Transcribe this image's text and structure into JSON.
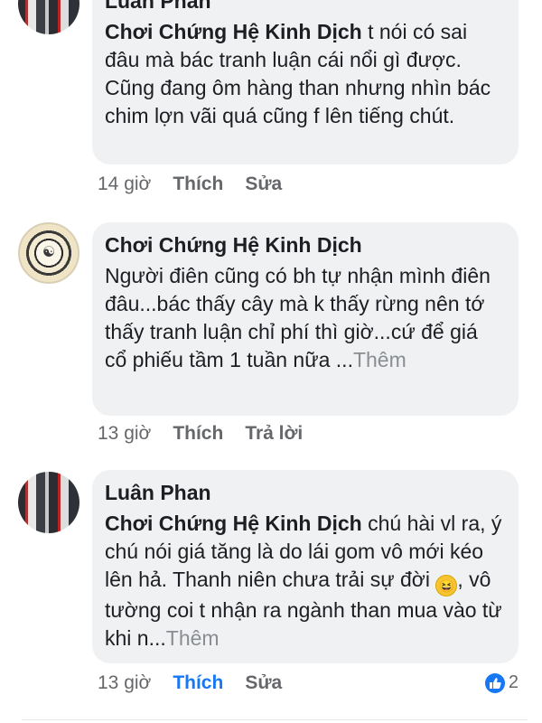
{
  "comments": [
    {
      "author": "Luân Phan",
      "tag": "Chơi Chứng Hệ Kinh Dịch",
      "text": " t nói có sai đâu mà bác tranh luận cái nổi gì được. Cũng đang ôm hàng than nhưng nhìn bác chim lợn vãi quá cũng f lên tiếng chút.",
      "time": "14 giờ",
      "like_label": "Thích",
      "second_action": "Sửa",
      "avatar_icon": "profile-photo-icon"
    },
    {
      "author": "Chơi Chứng Hệ Kinh Dịch",
      "text": "Người điên cũng có bh tự nhận mình điên đâu...bác thấy cây mà k thấy rừng nên tớ thấy tranh luận chỉ phí thì giờ...cứ để giá cổ phiếu tầm 1 tuần nữa ...",
      "more": "Thêm",
      "time": "13 giờ",
      "like_label": "Thích",
      "second_action": "Trả lời",
      "avatar_icon": "bagua-seal-icon"
    },
    {
      "author": "Luân Phan",
      "tag": "Chơi Chứng Hệ Kinh Dịch",
      "text_part1": " chú hài vl ra, ý chú nói giá tăng là do lái gom vô mới kéo lên hả. Thanh niên chưa trải sự đời ",
      "emoji": "😆",
      "text_part2": ", vô tường coi t nhận ra ngành than mua vào từ khi n...",
      "more": "Thêm",
      "time": "13 giờ",
      "like_label": "Thích",
      "second_action": "Sửa",
      "reaction_count": "2",
      "liked": true,
      "avatar_icon": "profile-photo-icon"
    }
  ],
  "colors": {
    "bubble": "#eff1f3",
    "link_blue": "#1877f2",
    "meta_gray": "#65676b"
  }
}
